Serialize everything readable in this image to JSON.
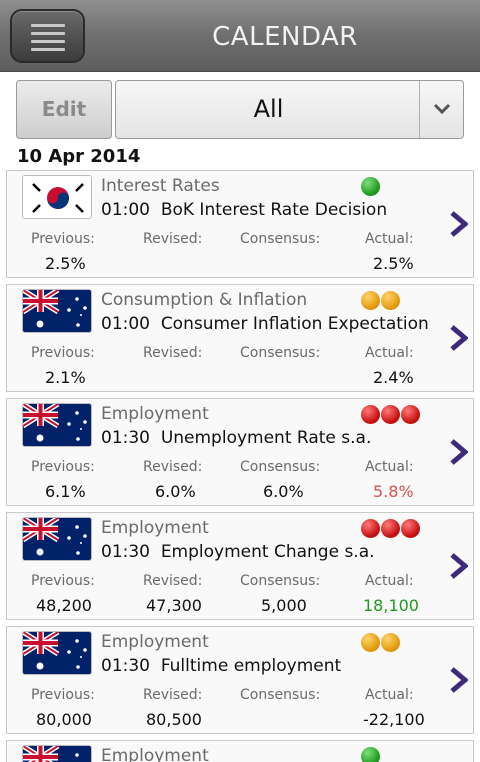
{
  "header": {
    "title": "CALENDAR",
    "menu_icon": "menu-icon"
  },
  "filter": {
    "edit_label": "Edit",
    "selected": "All"
  },
  "date": "10 Apr 2014",
  "labels": {
    "previous": "Previous:",
    "revised": "Revised:",
    "consensus": "Consensus:",
    "actual": "Actual:"
  },
  "colors": {
    "actual_negative": "#d9534f",
    "actual_positive": "#1f9a1f"
  },
  "events": [
    {
      "flag": "south-korea",
      "category": "Interest Rates",
      "time": "01:00",
      "name": "BoK Interest Rate Decision",
      "importance": "green",
      "importance_count": 1,
      "previous": "2.5%",
      "revised": "",
      "consensus": "",
      "actual": "2.5%",
      "actual_color": ""
    },
    {
      "flag": "australia",
      "category": "Consumption & Inflation",
      "time": "01:00",
      "name": "Consumer Inflation Expectation",
      "importance": "orange",
      "importance_count": 2,
      "previous": "2.1%",
      "revised": "",
      "consensus": "",
      "actual": "2.4%",
      "actual_color": ""
    },
    {
      "flag": "australia",
      "category": "Employment",
      "time": "01:30",
      "name": "Unemployment Rate s.a.",
      "importance": "red",
      "importance_count": 3,
      "previous": "6.1%",
      "revised": "6.0%",
      "consensus": "6.0%",
      "actual": "5.8%",
      "actual_color": "negative"
    },
    {
      "flag": "australia",
      "category": "Employment",
      "time": "01:30",
      "name": "Employment Change s.a.",
      "importance": "red",
      "importance_count": 3,
      "previous": "48,200",
      "revised": "47,300",
      "consensus": "5,000",
      "actual": "18,100",
      "actual_color": "positive"
    },
    {
      "flag": "australia",
      "category": "Employment",
      "time": "01:30",
      "name": "Fulltime employment",
      "importance": "orange",
      "importance_count": 2,
      "previous": "80,000",
      "revised": "80,500",
      "consensus": "",
      "actual": "-22,100",
      "actual_color": ""
    },
    {
      "flag": "australia",
      "category": "Employment",
      "time": "",
      "name": "",
      "importance": "green",
      "importance_count": 1,
      "previous": "",
      "revised": "",
      "consensus": "",
      "actual": "",
      "actual_color": ""
    }
  ]
}
